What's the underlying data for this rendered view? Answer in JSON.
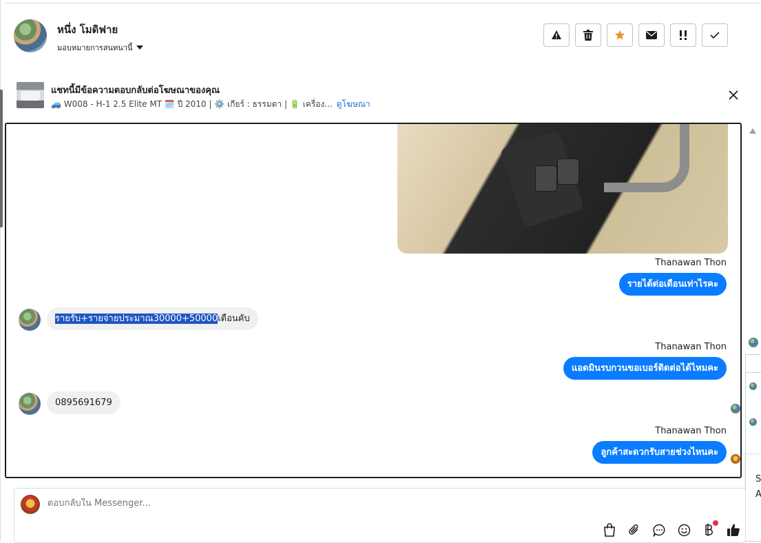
{
  "header": {
    "name": "หนึ่ง โมดิฟาย",
    "assign_label": "มอบหมายการสนทนานี้"
  },
  "ad": {
    "title": "แชทนี้มีข้อความตอบกลับต่อโฆษณาของคุณ",
    "details": "🚙 W008 - H-1 2.5 Elite MT 🗓️ ปี 2010 | ⚙️ เกียร์ : ธรรมดา | 🔋 เครื่อง...",
    "link": "ดูโฆษณา"
  },
  "messages": {
    "m1_sender": "Thanawan Thon",
    "m1_text": "รายได้ต่อเดือนเท่าไรคะ",
    "m2_selected": "รายรับ+รายจ่ายประมาณ30000+50000",
    "m2_rest": "เดือนคับ",
    "m3_sender": "Thanawan Thon",
    "m3_text": "แอดมินรบกวนขอเบอร์ติดต่อได้ไหมคะ",
    "m4_text": "0895691679",
    "m5_sender": "Thanawan Thon",
    "m5_text": "ลูกค้าสะดวกรับสายช่วงไหนคะ"
  },
  "side_panel": {
    "text1": "Se",
    "text2": "A"
  },
  "composer": {
    "placeholder": "ตอบกลับใน Messenger..."
  },
  "colors": {
    "accent": "#0a7cff",
    "selection": "#1f56c2",
    "star": "#f0932b",
    "notification": "#f02849"
  },
  "icons": [
    "warning-icon",
    "trash-icon",
    "star-icon",
    "mail-icon",
    "important-icon",
    "check-icon",
    "close-icon",
    "bag-icon",
    "paperclip-icon",
    "chat-icon",
    "emoji-icon",
    "baht-icon",
    "thumbs-up-icon"
  ]
}
